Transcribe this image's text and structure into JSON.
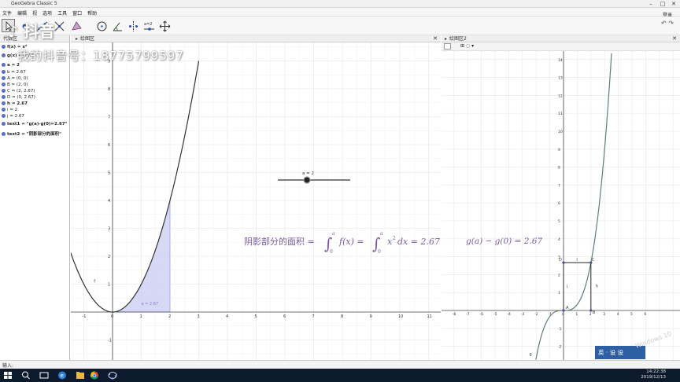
{
  "window": {
    "title": "GeoGebra Classic 5"
  },
  "menu": [
    "文件",
    "编辑",
    "视",
    "选项",
    "工具",
    "窗口",
    "帮助"
  ],
  "menu_right": "登录",
  "toolbar": {
    "tools": [
      "move-tool",
      "point-tool",
      "line-tool",
      "perpendicular-tool",
      "polygon-tool",
      "circle-tool",
      "ellipse-tool",
      "angle-tool",
      "reflect-tool",
      "slider-tool",
      "move-graphics-tool"
    ],
    "right_icons": [
      "undo-icon",
      "redo-icon"
    ]
  },
  "watermark": {
    "app": "抖音",
    "account": "我的抖音号：18775799597"
  },
  "algebra": {
    "header": "代数区",
    "items": [
      {
        "text": "f(x) = x²",
        "style": "bold",
        "dot": "filled"
      },
      {
        "text": "g(x) = x³/3",
        "style": "bold",
        "dot": "filled"
      },
      {
        "text": "a = 2",
        "style": "bold",
        "dot": "filled"
      },
      {
        "text": "b = 2.67",
        "style": "normal",
        "dot": "filled"
      },
      {
        "text": "A = (0, 0)",
        "style": "normal",
        "dot": "filled"
      },
      {
        "text": "B = (2, 0)",
        "style": "normal",
        "dot": "filled"
      },
      {
        "text": "C = (2, 2.67)",
        "style": "normal",
        "dot": "filled"
      },
      {
        "text": "D = (0, 2.67)",
        "style": "normal",
        "dot": "filled"
      },
      {
        "text": "h = 2.67",
        "style": "bold",
        "dot": "filled"
      },
      {
        "text": "i = 2",
        "style": "normal",
        "dot": "filled"
      },
      {
        "text": "j = 2.67",
        "style": "normal",
        "dot": "filled"
      },
      {
        "text": "text1 = \"g(a)-g(0)=2.67\"",
        "style": "bold",
        "dot": "filled"
      },
      {
        "text": "text2 = \"阴影部分的面积\"",
        "style": "bold",
        "dot": "filled"
      }
    ]
  },
  "graphics1": {
    "header": "绘图区",
    "slider_label": "a = 2",
    "formula": {
      "prefix": "阴影部分的面积 =",
      "int1_upper": "a",
      "int1_lower": "0",
      "int1_body": "f(x) =",
      "int2_upper": "a",
      "int2_lower": "0",
      "int2_body": "x",
      "exponent": "2",
      "int2_tail": "dx = 2.67"
    },
    "area_label": "a = 2.67",
    "curve_label": "f",
    "x_ticks": [
      "-1",
      "0",
      "1",
      "2",
      "3",
      "4",
      "5",
      "6",
      "7",
      "8",
      "9",
      "10",
      "11"
    ],
    "y_ticks": [
      "-1",
      "1",
      "2",
      "3",
      "4",
      "5",
      "6",
      "7",
      "8",
      "9"
    ],
    "curve_color": "#333333",
    "fill_color": "#c8cbf3",
    "text_color": "#7b5b9e"
  },
  "graphics2": {
    "header": "绘图区2",
    "formula": "g(a) − g(0) = 2.67",
    "x_ticks": [
      "-8",
      "-7",
      "-6",
      "-5",
      "-4",
      "-3",
      "-2",
      "-1",
      "0",
      "1",
      "2",
      "3",
      "4",
      "5",
      "6"
    ],
    "y_ticks": [
      "-2",
      "-1",
      "1",
      "2",
      "3",
      "4",
      "5",
      "6",
      "7",
      "8",
      "9",
      "10",
      "11",
      "12",
      "13",
      "14"
    ],
    "point_labels": {
      "A": "A",
      "B": "B",
      "C": "C",
      "D": "D"
    },
    "segment_labels": {
      "h": "h",
      "i": "i",
      "j": "j"
    },
    "curve_label": "g",
    "curve_color": "#5f7f6f"
  },
  "input_bar": {
    "label": "输入:"
  },
  "taskbar": {
    "time": "14:22:38",
    "date": "2019/12/13"
  },
  "ime": {
    "text": "英 · 设 设"
  },
  "os_watermark": "Windows 10"
}
